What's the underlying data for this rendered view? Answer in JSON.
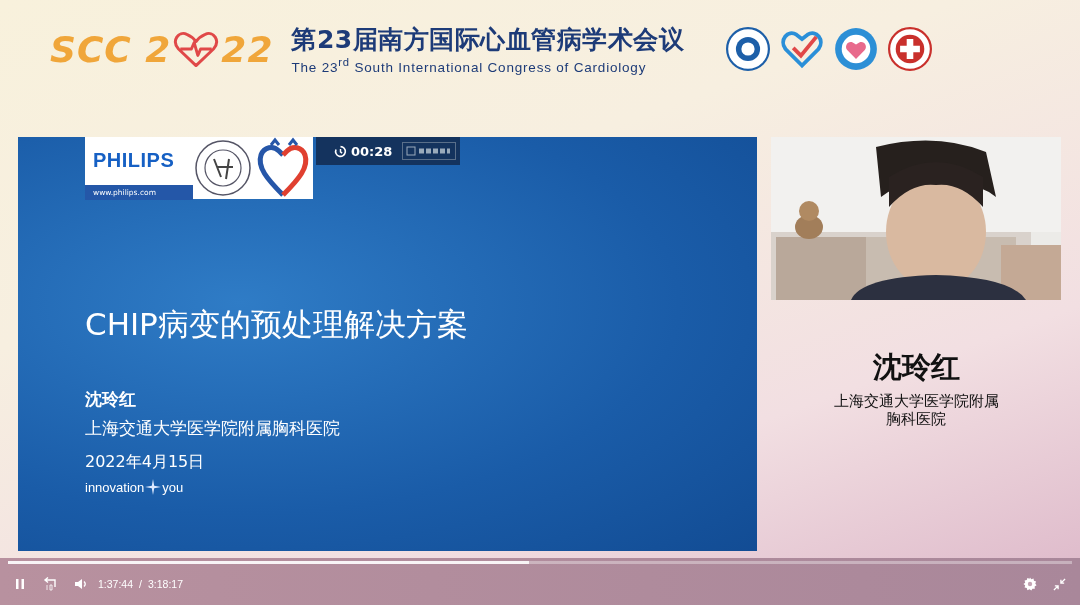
{
  "header": {
    "logo": {
      "text_start": "SCC 2",
      "text_end": "22"
    },
    "title": "第23届南方国际心血管病学术会议",
    "subtitle": "The 23$^{rd}$ South International Congress of Cardiology"
  },
  "slide": {
    "sponsor": "PHILIPS",
    "sponsor_url": "www.philips.com",
    "timer": "00:28",
    "title": "CHIP病变的预处理解决方案",
    "speaker": "沈玲红",
    "affiliation": "上海交通大学医学院附属胸科医院",
    "date": "2022年4月15日",
    "tagline_start": "innovation",
    "tagline_end": "you"
  },
  "speaker_panel": {
    "name": "沈玲红",
    "affiliation_lines": [
      "上海交通大学医学院附属",
      "胸科医院"
    ]
  },
  "player": {
    "progress": {
      "level": 0.49
    },
    "playing": true,
    "current_time": "1:37:44",
    "separator": "/",
    "duration": "3:18:17"
  }
}
